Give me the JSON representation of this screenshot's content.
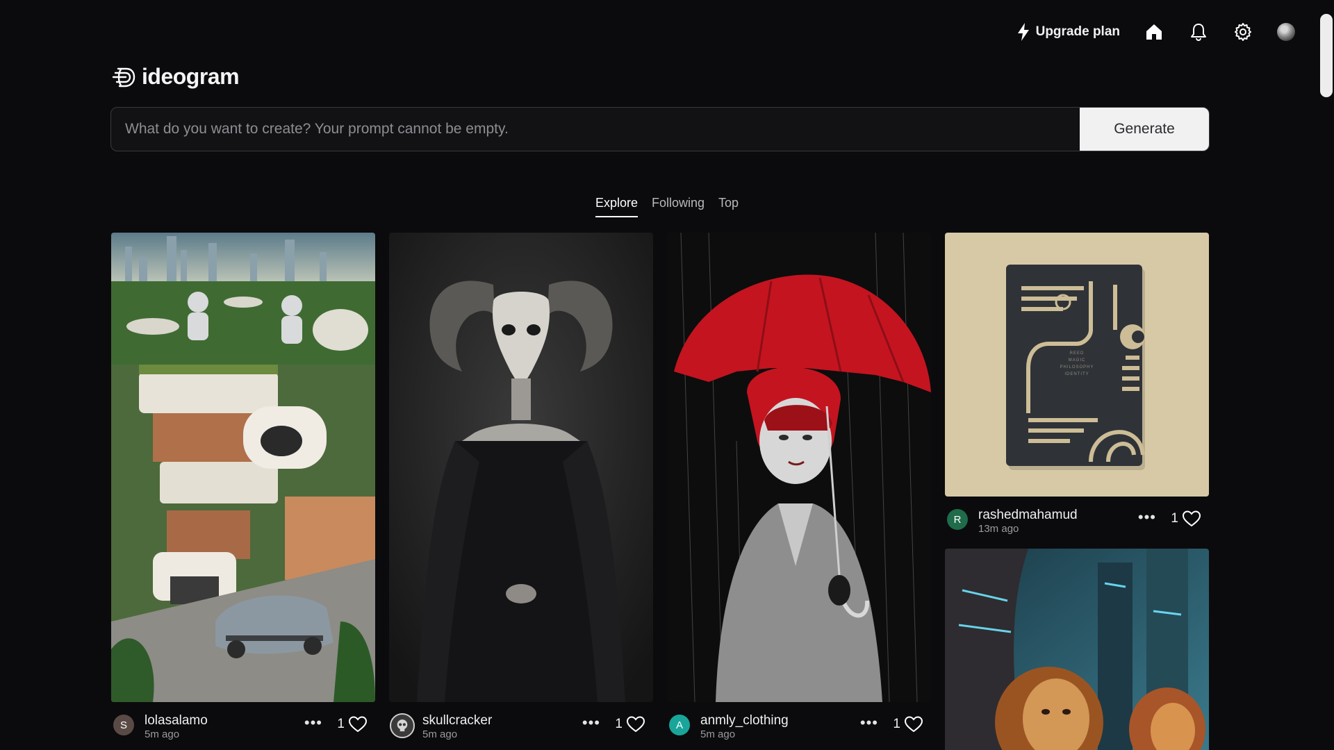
{
  "header": {
    "upgrade_label": "Upgrade plan",
    "icons": [
      "lightning-icon",
      "home-icon",
      "bell-icon",
      "gear-icon",
      "avatar"
    ]
  },
  "logo": {
    "text": "ideogram"
  },
  "prompt": {
    "value": "",
    "placeholder": "What do you want to create? Your prompt cannot be empty.",
    "button_label": "Generate"
  },
  "tabs": [
    {
      "label": "Explore",
      "active": true
    },
    {
      "label": "Following",
      "active": false
    },
    {
      "label": "Top",
      "active": false
    }
  ],
  "feed": [
    {
      "username": "lolasalamo",
      "time": "5m ago",
      "likes": "1",
      "avatar_letter": "S",
      "avatar_color": "#5a4a46",
      "image": "robots-eco-city"
    },
    {
      "username": "skullcracker",
      "time": "5m ago",
      "likes": "1",
      "avatar_letter": "",
      "avatar_color": "#3a3a3a",
      "image": "ram-skull-woman"
    },
    {
      "username": "anmly_clothing",
      "time": "5m ago",
      "likes": "1",
      "avatar_letter": "A",
      "avatar_color": "#1aa59a",
      "image": "red-umbrella-woman"
    },
    {
      "username": "rashedmahamud",
      "time": "13m ago",
      "likes": "1",
      "avatar_letter": "R",
      "avatar_color": "#1f6b4a",
      "image": "book-cover"
    },
    {
      "image": "lions-sci-fi"
    }
  ],
  "book_text": [
    "REED",
    "MAGIC",
    "PHILOSOPHY",
    "IDENTITY"
  ],
  "colors": {
    "background": "#0b0b0d",
    "accent_red": "#c41420",
    "book_bg": "#d8c9a6"
  }
}
